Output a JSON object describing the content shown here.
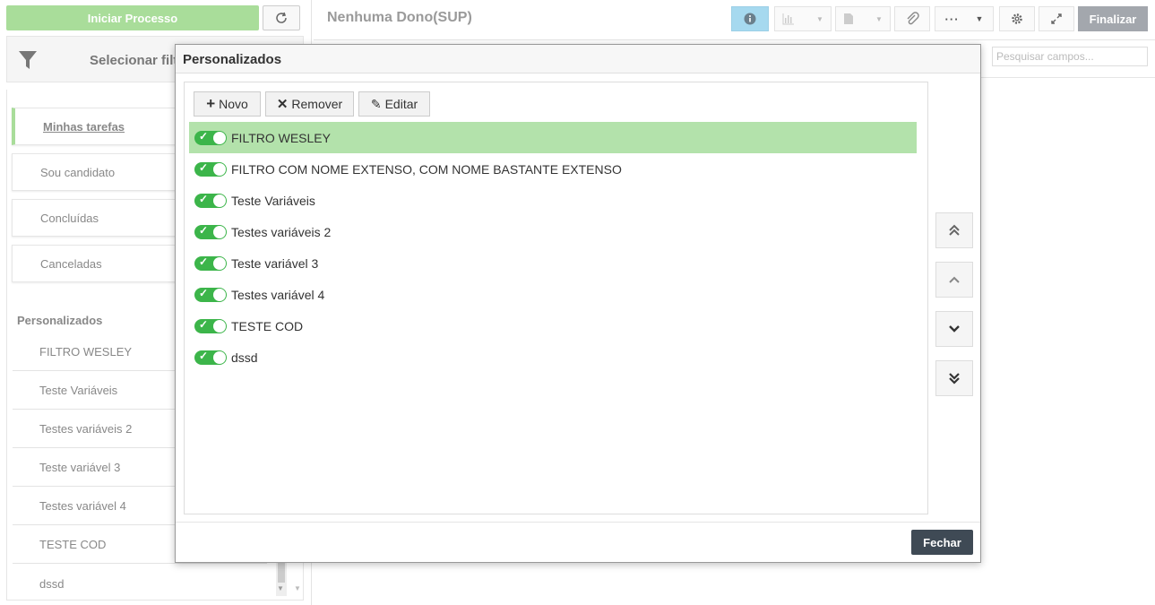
{
  "sidebar": {
    "start_button": "Iniciar Processo",
    "filter_label": "Selecionar filtro",
    "tasks": [
      {
        "label": "Minhas tarefas"
      },
      {
        "label": "Sou candidato"
      },
      {
        "label": "Concluídas"
      },
      {
        "label": "Canceladas"
      }
    ],
    "section_title": "Personalizados",
    "custom_items": [
      {
        "label": "FILTRO WESLEY"
      },
      {
        "label": "Teste Variáveis"
      },
      {
        "label": "Testes variáveis 2"
      },
      {
        "label": "Teste variável 3"
      },
      {
        "label": "Testes variável 4"
      },
      {
        "label": "TESTE COD"
      },
      {
        "label": "dssd"
      }
    ]
  },
  "header": {
    "title": "Nenhuma Dono(SUP)",
    "finalize_button": "Finalizar",
    "search_placeholder": "Pesquisar campos..."
  },
  "modal": {
    "title": "Personalizados",
    "buttons": {
      "new": "Novo",
      "remove": "Remover",
      "edit": "Editar"
    },
    "filters": [
      {
        "label": "FILTRO WESLEY",
        "enabled": true,
        "selected": true
      },
      {
        "label": "FILTRO COM NOME EXTENSO, COM NOME BASTANTE EXTENSO",
        "enabled": true,
        "selected": false
      },
      {
        "label": "Teste Variáveis",
        "enabled": true,
        "selected": false
      },
      {
        "label": "Testes variáveis 2",
        "enabled": true,
        "selected": false
      },
      {
        "label": "Teste variável 3",
        "enabled": true,
        "selected": false
      },
      {
        "label": "Testes variável 4",
        "enabled": true,
        "selected": false
      },
      {
        "label": "TESTE COD",
        "enabled": true,
        "selected": false
      },
      {
        "label": "dssd",
        "enabled": true,
        "selected": false
      }
    ],
    "close_button": "Fechar"
  },
  "colors": {
    "primary_green": "#a9dd9a",
    "toggle_green": "#3cb54a",
    "selected_row": "#b3e2ab",
    "close_button": "#3f4a55"
  }
}
